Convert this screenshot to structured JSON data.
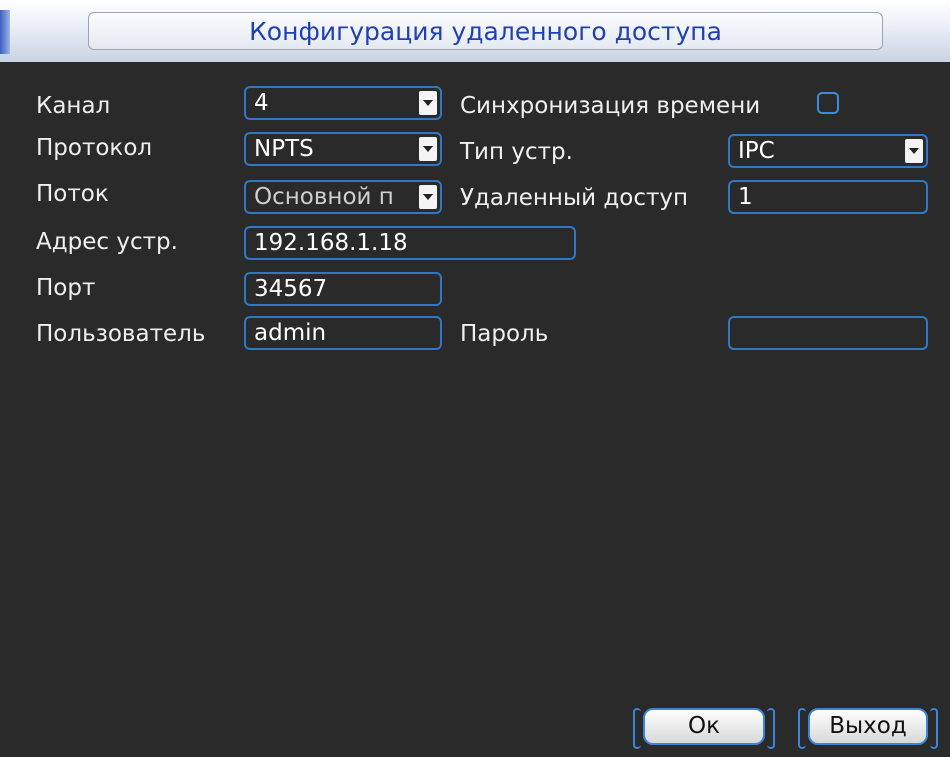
{
  "window": {
    "title": "Конфигурация удаленного доступа"
  },
  "labels": {
    "channel": "Канал",
    "protocol": "Протокол",
    "stream": "Поток",
    "device_address": "Адрес устр.",
    "port": "Порт",
    "user": "Пользователь",
    "time_sync": "Синхронизация времени",
    "device_type": "Тип устр.",
    "remote_access": "Удаленный доступ",
    "password": "Пароль"
  },
  "values": {
    "channel": "4",
    "protocol": "NPTS",
    "stream": "Основной п",
    "device_address": "192.168.1.18",
    "port": "34567",
    "user": "admin",
    "device_type": "IPC",
    "remote_access": "1",
    "password": "",
    "time_sync_checked": false
  },
  "buttons": {
    "ok": "Ок",
    "exit": "Выход"
  },
  "colors": {
    "accent": "#2f78c6",
    "title_text": "#1f3fb4",
    "background": "#2a2a2a"
  }
}
